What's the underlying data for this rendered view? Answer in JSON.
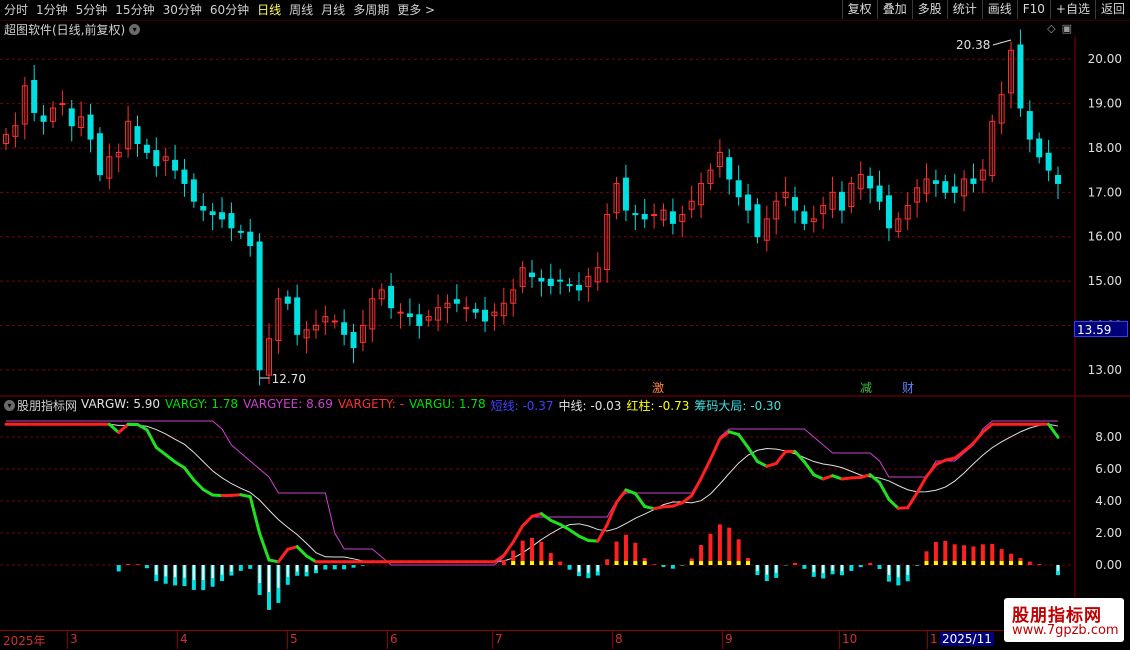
{
  "toolbar": {
    "left_items": [
      "分时",
      "1分钟",
      "5分钟",
      "15分钟",
      "30分钟",
      "60分钟",
      "日线",
      "周线",
      "月线",
      "多周期",
      "更多 >"
    ],
    "active_index": 6,
    "right_buttons": [
      "复权",
      "叠加",
      "多股",
      "统计",
      "画线",
      "F10",
      "+自选",
      "返回"
    ]
  },
  "chart_title": "超图软件(日线,前复权)",
  "price_axis": {
    "labels": [
      "20.00",
      "19.00",
      "18.00",
      "17.00",
      "16.00",
      "15.00",
      "14.00",
      "13.00"
    ],
    "current_price": "13.59",
    "high_label": "20.38",
    "low_label": "12.70"
  },
  "indicator": {
    "name": "股朋指标网",
    "values": [
      {
        "text": "VARGW: 5.90",
        "color": "#e0e0e0"
      },
      {
        "text": "VARGY: 1.78",
        "color": "#00e000"
      },
      {
        "text": "VARGYEE: 8.69",
        "color": "#d040d0"
      },
      {
        "text": "VARGETY: -",
        "color": "#ff3030"
      },
      {
        "text": "VARGU: 1.78",
        "color": "#00e000"
      },
      {
        "text": "短线: -0.37",
        "color": "#4040ff"
      },
      {
        "text": "中线: -0.03",
        "color": "#e0e0e0"
      },
      {
        "text": "红柱: -0.73",
        "color": "#ffff00"
      },
      {
        "text": "筹码大局: -0.30",
        "color": "#40e0e0"
      }
    ],
    "axis_labels": [
      "8.00",
      "6.00",
      "4.00",
      "2.00",
      "0.00"
    ]
  },
  "event_badges": [
    {
      "text": "激",
      "color": "#ff8040"
    },
    {
      "text": "减",
      "color": "#40c040"
    },
    {
      "text": "财",
      "color": "#6080ff"
    }
  ],
  "dates": {
    "labels": [
      "2025年",
      "3",
      "4",
      "5",
      "6",
      "7",
      "8",
      "9",
      "10",
      "1"
    ],
    "current": "2025/11"
  },
  "logo": {
    "line1": "股朋指标网",
    "line2": "www.7gpzb.com"
  },
  "colors": {
    "up": "#ff3030",
    "down": "#00e0e0",
    "grid": "#7a0000"
  },
  "chart_data": {
    "type": "candlestick",
    "period": "日线",
    "price_range": [
      12.5,
      20.5
    ],
    "closes": [
      18.3,
      18.5,
      19.4,
      18.8,
      18.6,
      18.9,
      19.0,
      18.5,
      18.7,
      18.2,
      17.4,
      17.8,
      17.9,
      18.6,
      18.1,
      17.9,
      17.6,
      17.8,
      17.5,
      17.2,
      16.8,
      16.6,
      16.5,
      16.4,
      16.2,
      16.1,
      15.8,
      13.0,
      13.7,
      14.6,
      14.5,
      13.8,
      13.9,
      14.0,
      14.2,
      14.1,
      13.8,
      13.5,
      14.0,
      14.6,
      14.8,
      14.4,
      14.3,
      14.2,
      14.0,
      14.2,
      14.4,
      14.5,
      14.5,
      14.4,
      14.3,
      14.1,
      14.3,
      14.5,
      14.8,
      15.3,
      15.1,
      15.0,
      14.9,
      15.0,
      14.9,
      14.8,
      15.1,
      15.3,
      16.5,
      17.2,
      16.6,
      16.5,
      16.4,
      16.5,
      16.6,
      16.3,
      16.5,
      16.8,
      17.2,
      17.5,
      17.9,
      17.3,
      16.9,
      16.6,
      16.0,
      16.4,
      16.8,
      17.0,
      16.6,
      16.3,
      16.4,
      16.7,
      17.0,
      16.6,
      17.2,
      17.4,
      17.1,
      16.8,
      16.2,
      16.4,
      16.7,
      17.1,
      17.3,
      17.2,
      17.0,
      17.0,
      17.3,
      17.2,
      17.5,
      18.6,
      19.2,
      20.2,
      18.9,
      18.2,
      17.8,
      17.5,
      17.2
    ],
    "indicator_lines": {
      "VARGW": "white smooth line",
      "VARGYEE": "magenta step line",
      "VARGU": "red/green trend line"
    }
  }
}
